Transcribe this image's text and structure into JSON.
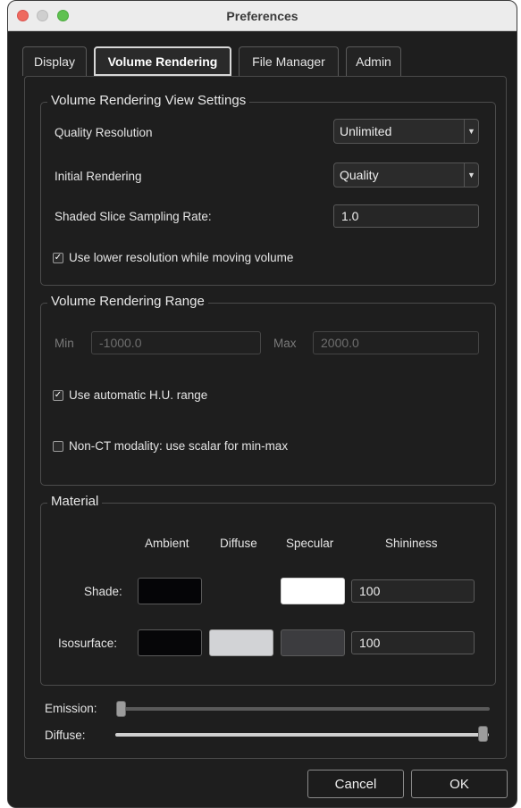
{
  "window": {
    "title": "Preferences"
  },
  "tabs": [
    {
      "label": "Display",
      "active": false
    },
    {
      "label": "Volume Rendering",
      "active": true
    },
    {
      "label": "File Manager",
      "active": false
    },
    {
      "label": "Admin",
      "active": false
    }
  ],
  "view_settings": {
    "title": "Volume Rendering View Settings",
    "quality_resolution_label": "Quality Resolution",
    "quality_resolution_value": "Unlimited",
    "initial_rendering_label": "Initial Rendering",
    "initial_rendering_value": "Quality",
    "sampling_rate_label": "Shaded Slice Sampling Rate:",
    "sampling_rate_value": "1.0",
    "lower_res_label": "Use lower resolution while moving volume",
    "lower_res_checked": true
  },
  "range": {
    "title": "Volume Rendering Range",
    "min_label": "Min",
    "min_value": "-1000.0",
    "max_label": "Max",
    "max_value": "2000.0",
    "auto_hu_label": "Use automatic H.U. range",
    "auto_hu_checked": true,
    "non_ct_label": "Non-CT modality: use scalar for min-max",
    "non_ct_checked": false
  },
  "material": {
    "title": "Material",
    "col_ambient": "Ambient",
    "col_diffuse": "Diffuse",
    "col_specular": "Specular",
    "col_shininess": "Shininess",
    "shade_label": "Shade:",
    "shade_shininess": "100",
    "isosurface_label": "Isosurface:",
    "isosurface_shininess": "100",
    "colors": {
      "shade_ambient": "#050507",
      "shade_specular": "#ffffff",
      "iso_ambient": "#060608",
      "iso_diffuse": "#d2d3d6",
      "iso_specular": "#3c3c3f"
    }
  },
  "sliders": {
    "emission_label": "Emission:",
    "emission_level": 0.0,
    "diffuse_label": "Diffuse:",
    "diffuse_level": 1.0
  },
  "buttons": {
    "cancel": "Cancel",
    "ok": "OK"
  }
}
